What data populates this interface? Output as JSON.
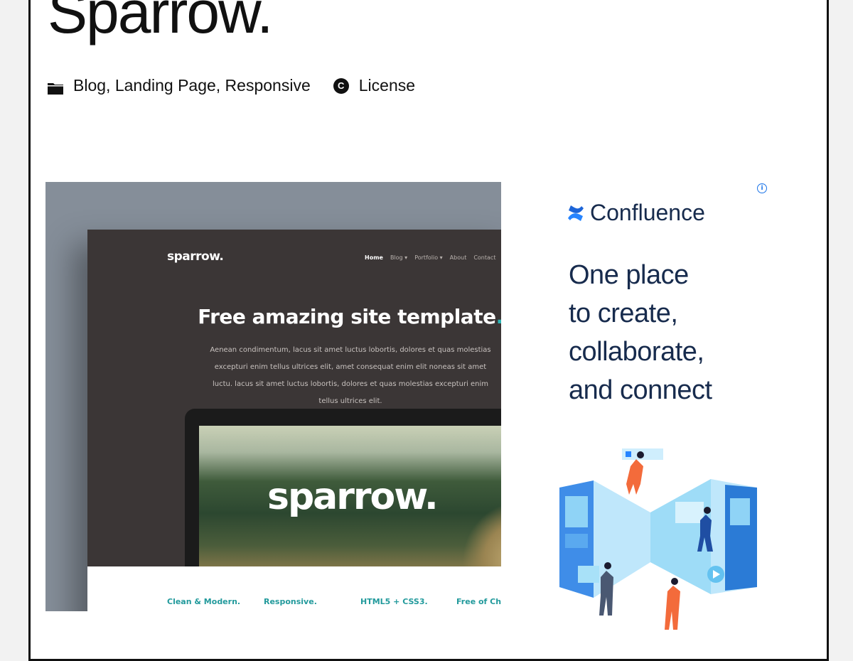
{
  "page": {
    "title": "Sparrow.",
    "categories": "Blog, Landing Page, Responsive",
    "license_label": "License",
    "icons": {
      "categories": "folder-icon",
      "license": "copyright-icon"
    }
  },
  "preview": {
    "logo": "sparrow.",
    "nav": [
      "Home",
      "Blog ▾",
      "Portfolio ▾",
      "About",
      "Contact"
    ],
    "headline": "Free amazing site template",
    "headline_dot": ".",
    "body": "Aenean condimentum, lacus sit amet luctus lobortis, dolores et quas molestias excepturi enim tellus ultrices elit, amet consequat enim elit noneas sit amet luctu. lacus sit amet luctus lobortis, dolores et quas molestias excepturi enim tellus ultrices elit.",
    "screen_logo": "sparrow.",
    "features": [
      "Clean & Modern.",
      "Responsive.",
      "HTML5 + CSS3.",
      "Free of Charg"
    ],
    "accent_color": "#229a9c"
  },
  "ad": {
    "brand": "Confluence",
    "headline_lines": [
      "One place",
      "to create,",
      "collaborate,",
      "and connect"
    ],
    "info_icon": "info-icon",
    "brand_color": "#2684ff",
    "text_color": "#172b4d"
  }
}
